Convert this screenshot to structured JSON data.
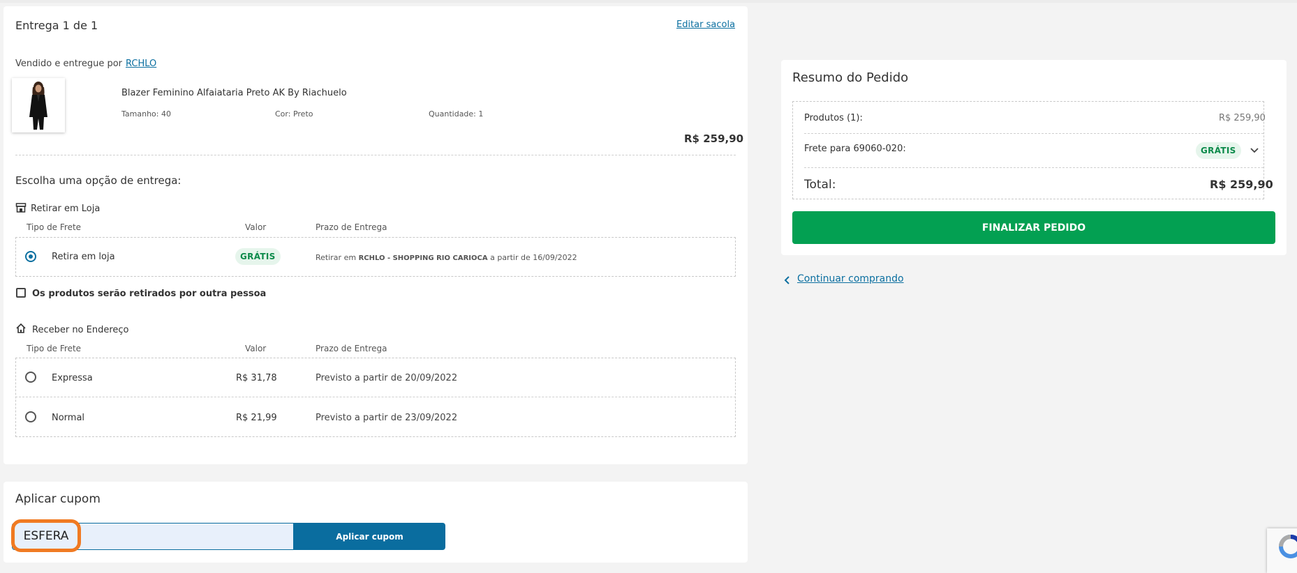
{
  "delivery": {
    "title": "Entrega 1 de 1",
    "edit_link": "Editar sacola",
    "sold_by_label": "Vendido e entregue por",
    "seller": "RCHLO",
    "product": {
      "name": "Blazer Feminino Alfaiataria Preto AK By Riachuelo",
      "size_label": "Tamanho:",
      "size": "40",
      "color_label": "Cor:",
      "color": "Preto",
      "qty_label": "Quantidade:",
      "qty": "1",
      "price": "R$ 259,90"
    },
    "choose_label": "Escolha uma opção de entrega:",
    "col_type": "Tipo de Frete",
    "col_value": "Valor",
    "col_deadline": "Prazo de Entrega",
    "pickup": {
      "section_title": "Retirar em Loja",
      "option_label": "Retira em loja",
      "value": "GRÁTIS",
      "deadline_prefix": "Retirar em",
      "store": "RCHLO - SHOPPING RIO CARIOCA",
      "deadline_suffix": "a partir de 16/09/2022",
      "other_person_label": "Os produtos serão retirados por outra pessoa"
    },
    "home": {
      "section_title": "Receber no Endereço",
      "options": [
        {
          "label": "Expressa",
          "value": "R$ 31,78",
          "deadline": "Previsto a partir de 20/09/2022"
        },
        {
          "label": "Normal",
          "value": "R$ 21,99",
          "deadline": "Previsto a partir de 23/09/2022"
        }
      ]
    }
  },
  "coupon": {
    "title": "Aplicar cupom",
    "input_value": "ESFERA",
    "button": "Aplicar cupom"
  },
  "summary": {
    "title": "Resumo do Pedido",
    "products_label": "Produtos (1):",
    "products_value": "R$ 259,90",
    "shipping_label": "Frete para 69060-020:",
    "shipping_value": "GRÁTIS",
    "total_label": "Total:",
    "total_value": "R$ 259,90",
    "checkout_button": "FINALIZAR PEDIDO",
    "continue_link": "Continuar comprando"
  },
  "colors": {
    "accent_blue": "#0a6d9f",
    "success_green": "#03a052",
    "highlight_orange": "#f07a22"
  }
}
